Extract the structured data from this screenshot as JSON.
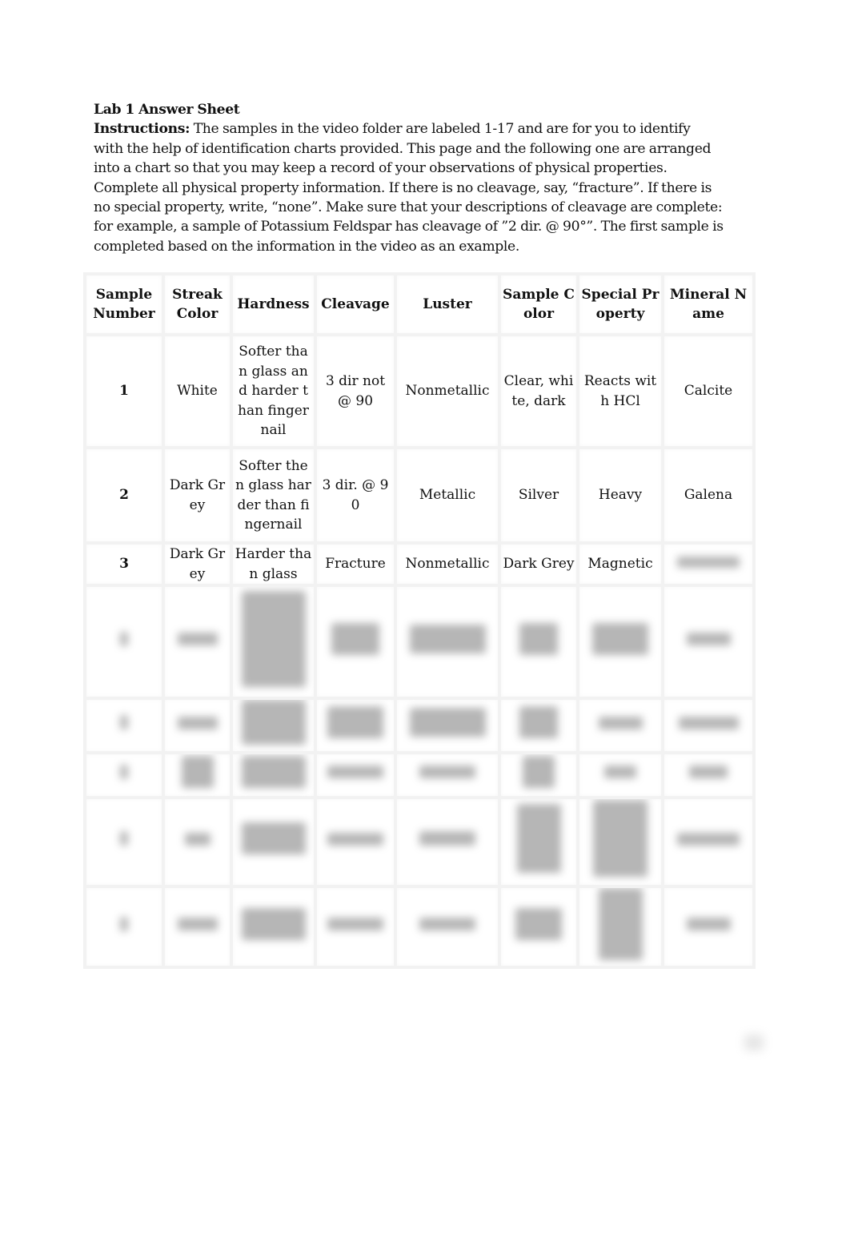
{
  "document": {
    "title": "Lab 1 Answer Sheet",
    "instructions_label": "Instructions:",
    "instruction_lines": [
      " The samples in the video folder are labeled 1-17 and are for you to identify",
      "with the help of identification charts provided.  This page and the following one are arranged",
      "into a chart so that you may keep a record of your observations of physical properties.",
      "Complete all physical property information.  If there is no cleavage, say, “fracture”.  If there is",
      "no special property, write, “none”.  Make sure that your descriptions of cleavage are complete:",
      "for example, a sample of Potassium Feldspar has cleavage of  ”2 dir. @ 90°”.  The first sample is",
      "completed based on the information in the video as an example."
    ]
  },
  "table": {
    "headers": [
      "Sample Number",
      "Streak Color",
      "Hardness",
      "Cleavage",
      "Luster",
      "Sample Color",
      "Special Property",
      "Mineral Name"
    ],
    "rows": [
      {
        "sample_number": "1",
        "streak_color": "White",
        "hardness": "Softer than glass and harder than fingernail",
        "cleavage": "3 dir not @ 90",
        "luster": "Nonmetallic",
        "sample_color": "Clear, white, dark",
        "special_property": "Reacts with HCl",
        "mineral_name": "Calcite"
      },
      {
        "sample_number": "2",
        "streak_color": "Dark Grey",
        "hardness": "Softer then glass harder than fingernail",
        "cleavage": "3 dir. @ 90",
        "luster": "Metallic",
        "sample_color": "Silver",
        "special_property": "Heavy",
        "mineral_name": "Galena"
      },
      {
        "sample_number": "3",
        "streak_color": "Dark Grey",
        "hardness": "Harder than glass",
        "cleavage": "Fracture",
        "luster": "Nonmetallic",
        "sample_color": "Dark Grey",
        "special_property": "Magnetic",
        "mineral_name": "[blurred]"
      }
    ],
    "blurred_rows_count": 5,
    "blurred_placeholder": "[blurred]"
  },
  "page_number": "[blurred]"
}
